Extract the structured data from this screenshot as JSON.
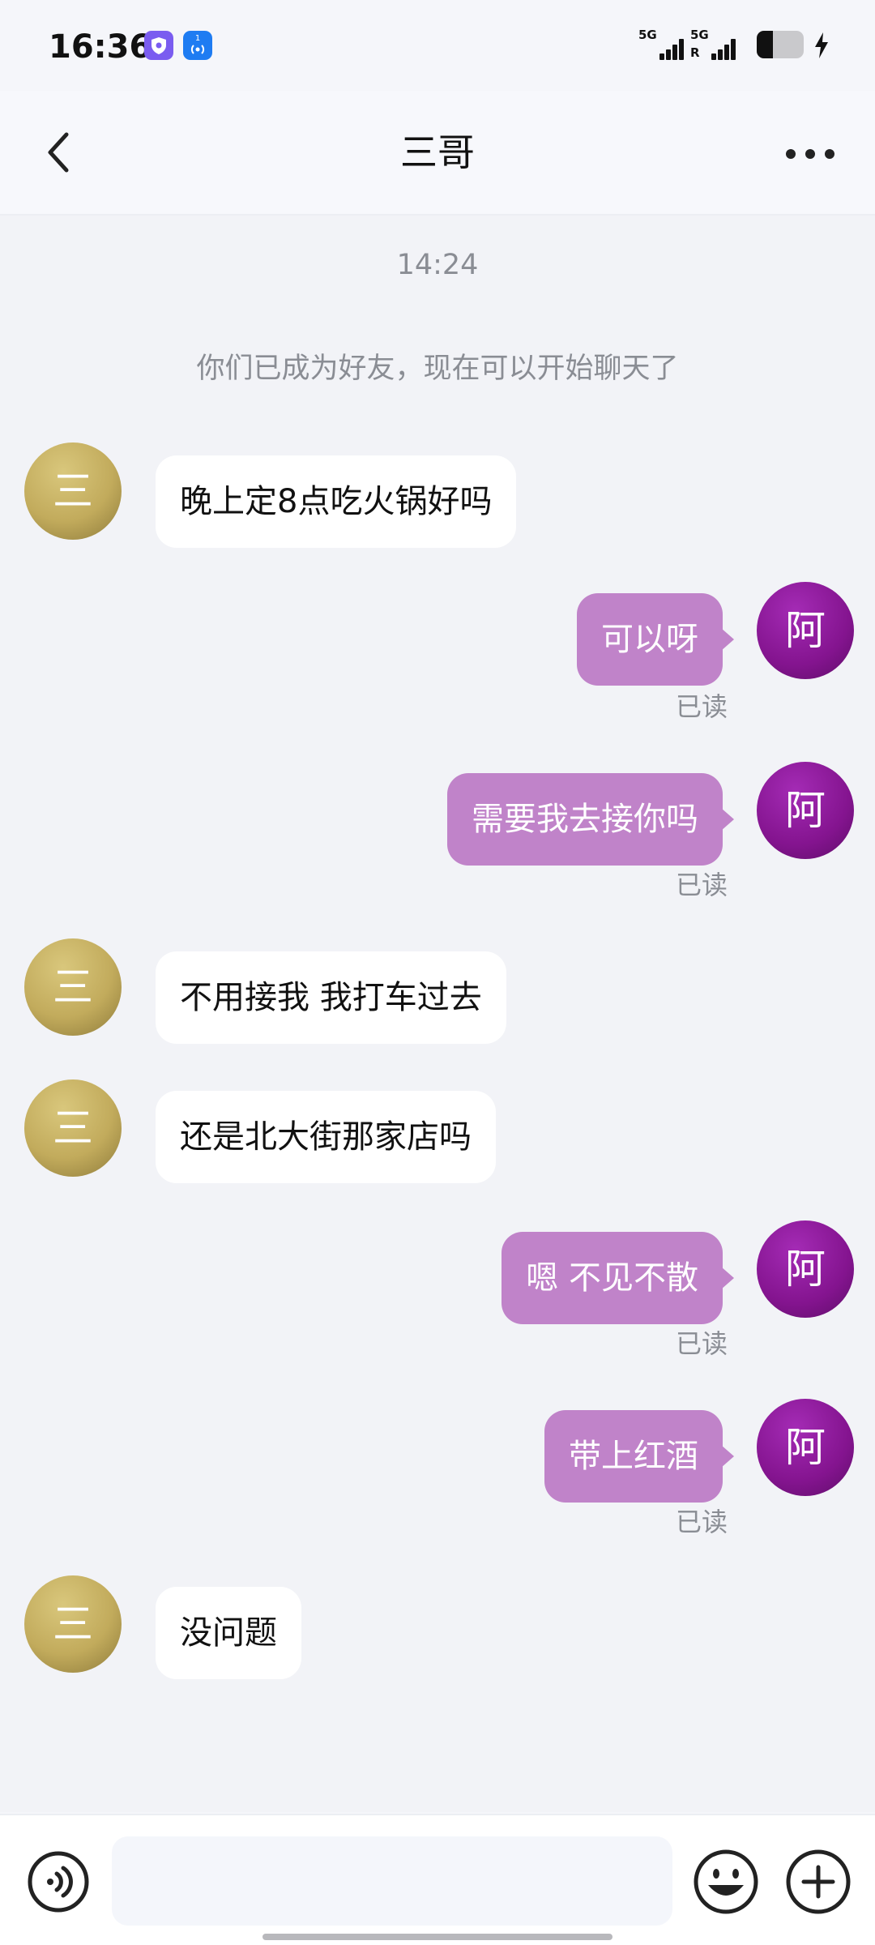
{
  "status_bar": {
    "time": "16:36",
    "sim1_label": "5G",
    "sim2_label": "5G",
    "sim2_sub": "R",
    "nfc_badge": "1",
    "battery_percent": 35,
    "icons": [
      "vpn-icon",
      "nfc-icon",
      "signal-icon",
      "battery-icon",
      "charging-icon"
    ]
  },
  "header": {
    "title": "三哥",
    "back_icon": "chevron-left-icon",
    "more_icon": "more-horizontal-icon"
  },
  "chat": {
    "time_divider": "14:24",
    "system_notice": "你们已成为好友，现在可以开始聊天了",
    "other_avatar_text": "三",
    "me_avatar_text": "阿",
    "messages": [
      {
        "sender": "other",
        "text": "晚上定8点吃火锅好吗"
      },
      {
        "sender": "me",
        "text": "可以呀",
        "status": "已读"
      },
      {
        "sender": "me",
        "text": "需要我去接你吗",
        "status": "已读"
      },
      {
        "sender": "other",
        "text": "不用接我 我打车过去"
      },
      {
        "sender": "other",
        "text": "还是北大街那家店吗"
      },
      {
        "sender": "me",
        "text": "嗯 不见不散",
        "status": "已读"
      },
      {
        "sender": "me",
        "text": "带上红酒",
        "status": "已读"
      },
      {
        "sender": "other",
        "text": "没问题"
      }
    ]
  },
  "input_bar": {
    "placeholder": "",
    "icons": [
      "voice-icon",
      "emoji-icon",
      "plus-icon"
    ]
  },
  "colors": {
    "me_bubble": "#c083c9",
    "other_bubble": "#ffffff",
    "me_avatar": "#84148f",
    "other_avatar": "#c2ab5c",
    "background": "#f2f3f7"
  }
}
